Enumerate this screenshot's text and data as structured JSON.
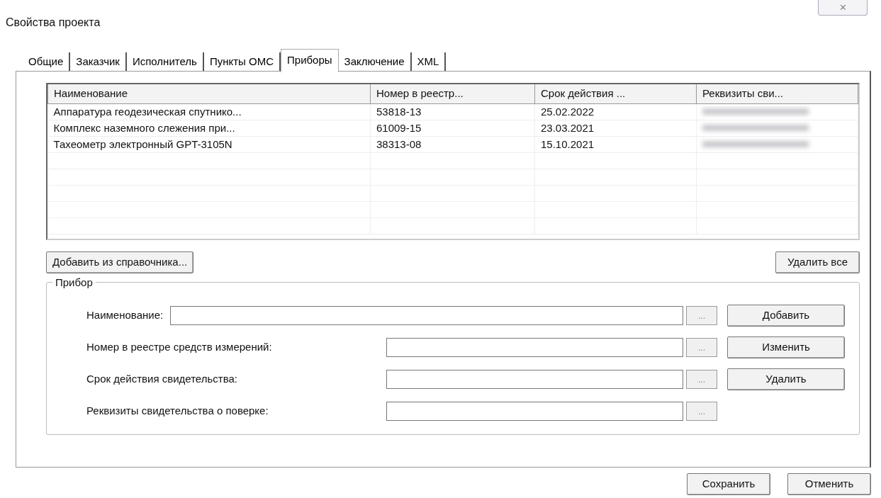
{
  "window": {
    "title": "Свойства проекта",
    "close": "✕"
  },
  "tabs": [
    {
      "label": "Общие",
      "selected": false
    },
    {
      "label": "Заказчик",
      "selected": false
    },
    {
      "label": "Исполнитель",
      "selected": false
    },
    {
      "label": "Пункты ОМС",
      "selected": false
    },
    {
      "label": "Приборы",
      "selected": true
    },
    {
      "label": "Заключение",
      "selected": false
    },
    {
      "label": "XML",
      "selected": false
    }
  ],
  "table": {
    "columns": [
      "Наименование",
      "Номер в реестр...",
      "Срок действия ...",
      "Реквизиты сви..."
    ],
    "rows": [
      [
        "Аппаратура геодезическая спутнико...",
        "53818-13",
        "25.02.2022"
      ],
      [
        "Комплекс наземного слежения при...",
        "61009-15",
        "23.03.2021"
      ],
      [
        "Тахеометр электронный GPT-3105N",
        "38313-08",
        "15.10.2021"
      ]
    ]
  },
  "add_from_catalog": "Добавить из справочника...",
  "delete_all": "Удалить все",
  "group": {
    "title": "Прибор",
    "fields": [
      {
        "label": "Наименование:",
        "browse": "...",
        "action": "Добавить"
      },
      {
        "label": "Номер в реестре средств измерений:",
        "browse": "...",
        "action": "Изменить"
      },
      {
        "label": "Срок действия свидетельства:",
        "browse": "...",
        "action": "Удалить"
      },
      {
        "label": "Реквизиты свидетельства о поверке:",
        "browse": "..."
      }
    ]
  },
  "buttons": [
    "Сохранить",
    "Отменить"
  ]
}
